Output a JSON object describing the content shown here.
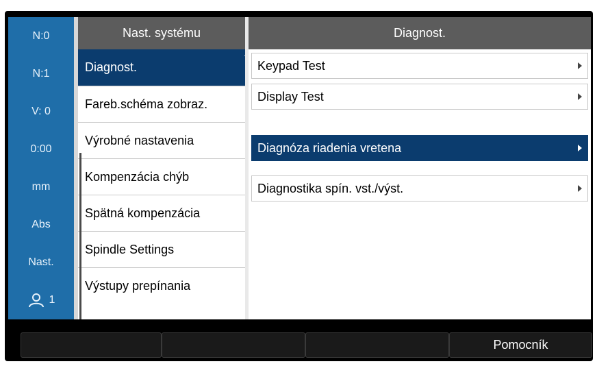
{
  "status_bar": {
    "items": [
      "N:0",
      "N:1",
      "V:  0",
      "0:00",
      "mm",
      "Abs",
      "Nast.",
      "1"
    ],
    "user_icon": "user-icon"
  },
  "menu": {
    "header": "Nast. systému",
    "items": [
      {
        "label": "Diagnost.",
        "selected": true
      },
      {
        "label": "Fareb.schéma zobraz.",
        "selected": false
      },
      {
        "label": "Výrobné nastavenia",
        "selected": false
      },
      {
        "label": "Kompenzácia chýb",
        "selected": false
      },
      {
        "label": "Spätná kompenzácia",
        "selected": false
      },
      {
        "label": "Spindle Settings",
        "selected": false
      },
      {
        "label": "Výstupy prepínania",
        "selected": false
      }
    ]
  },
  "panel": {
    "header": "Diagnost.",
    "items": [
      {
        "label": "Keypad Test",
        "selected": false
      },
      {
        "label": "Display Test",
        "selected": false
      },
      {
        "label": "Diagnóza riadenia vretena",
        "selected": true
      },
      {
        "label": "Diagnostika spín. vst./výst.",
        "selected": false
      }
    ]
  },
  "softkeys": [
    "",
    "",
    "",
    "Pomocník"
  ],
  "colors": {
    "status_blue": "#1f6ea9",
    "selection_navy": "#0b3c6e",
    "header_gray": "#5c5c5c",
    "frame_black": "#000000"
  }
}
